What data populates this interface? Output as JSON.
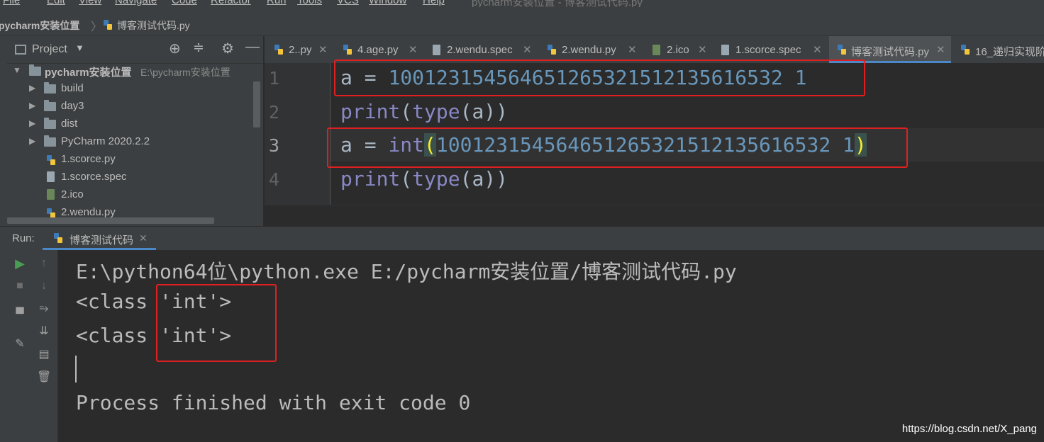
{
  "menu": {
    "items": [
      "File",
      "Edit",
      "View",
      "Navigate",
      "Code",
      "Refactor",
      "Run",
      "Tools",
      "VCS",
      "Window",
      "Help"
    ],
    "window_title": "pycharm安装位置 - 博客测试代码.py"
  },
  "breadcrumb": {
    "project": "pycharm安装位置",
    "file": "博客测试代码.py"
  },
  "project_panel": {
    "title": "Project",
    "root_name": "pycharm安装位置",
    "root_path": "E:\\pycharm安装位置",
    "items": [
      {
        "label": "build",
        "type": "folder"
      },
      {
        "label": "day3",
        "type": "folder"
      },
      {
        "label": "dist",
        "type": "folder"
      },
      {
        "label": "PyCharm 2020.2.2",
        "type": "folder"
      },
      {
        "label": "1.scorce.py",
        "type": "python"
      },
      {
        "label": "1.scorce.spec",
        "type": "file"
      },
      {
        "label": "2.ico",
        "type": "image"
      },
      {
        "label": "2.wendu.py",
        "type": "python"
      }
    ]
  },
  "tabs": [
    {
      "label": "2..py",
      "type": "python"
    },
    {
      "label": "4.age.py",
      "type": "python"
    },
    {
      "label": "2.wendu.spec",
      "type": "file"
    },
    {
      "label": "2.wendu.py",
      "type": "python"
    },
    {
      "label": "2.ico",
      "type": "image"
    },
    {
      "label": "1.scorce.spec",
      "type": "file"
    },
    {
      "label": "博客测试代码.py",
      "type": "python",
      "active": true
    },
    {
      "label": "16_递归实现阶",
      "type": "python"
    }
  ],
  "editor": {
    "line_numbers": [
      "1",
      "2",
      "3",
      "4"
    ],
    "line1": {
      "var": "a",
      "op": " = ",
      "number": "100123154564651265321512135616532 1"
    },
    "line2": {
      "fn": "print",
      "open": "(",
      "type_fn": "type",
      "arg": "(a))"
    },
    "line3": {
      "var": "a",
      "op": " = ",
      "fn": "int",
      "open": "(",
      "number": "100123154564651265321512135616532 1",
      "close": ")"
    },
    "line4": {
      "fn": "print",
      "open": "(",
      "type_fn": "type",
      "arg": "(a))"
    }
  },
  "run": {
    "label": "Run:",
    "tab": "博客测试代码",
    "output": [
      "E:\\python64位\\python.exe E:/pycharm安装位置/博客测试代码.py",
      "<class 'int'>",
      "<class 'int'>",
      "",
      "Process finished with exit code 0"
    ]
  },
  "watermark": "https://blog.csdn.net/X_pang",
  "colors": {
    "background": "#2b2b2b",
    "panel": "#3c3f41",
    "number": "#6897bb",
    "builtin": "#8888c6",
    "highlight_box": "#e02020",
    "run_green": "#499c54"
  }
}
